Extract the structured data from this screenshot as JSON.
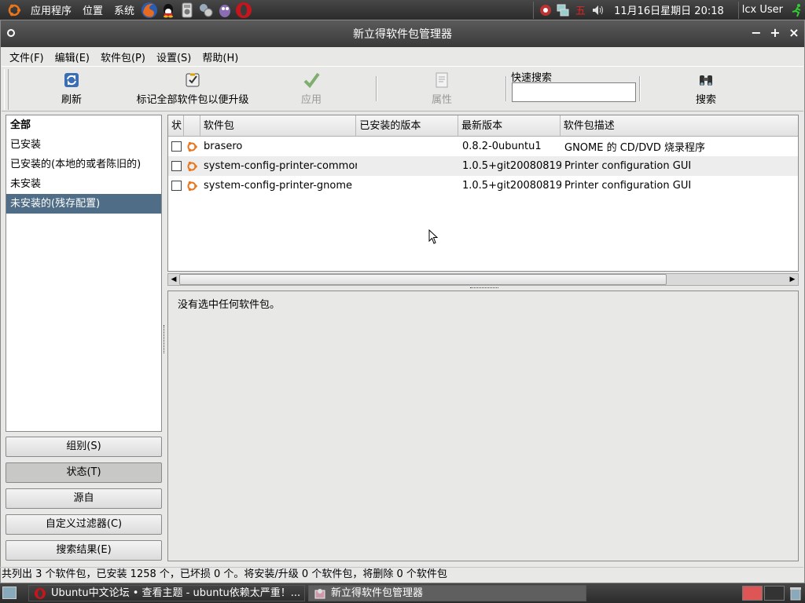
{
  "top_panel": {
    "menus": [
      "应用程序",
      "位置",
      "系统"
    ],
    "launchers": [
      "firefox-icon",
      "qq-icon",
      "media-player-icon",
      "network-tool-icon",
      "pidgin-icon",
      "opera-icon"
    ],
    "tray": [
      "update-icon",
      "network-icon",
      "input-method-icon",
      "volume-icon"
    ],
    "clock": "11月16日星期日 20:18",
    "user": "lcx User"
  },
  "window": {
    "title": "新立得软件包管理器",
    "controls": [
      "−",
      "+",
      "×"
    ]
  },
  "menubar": [
    "文件(F)",
    "编辑(E)",
    "软件包(P)",
    "设置(S)",
    "帮助(H)"
  ],
  "toolbar": {
    "refresh": "刷新",
    "mark_all": "标记全部软件包以便升级",
    "apply": "应用",
    "properties": "属性",
    "quick_search_label": "快速搜索",
    "quick_search_value": "",
    "search": "搜索"
  },
  "filters": {
    "items": [
      "全部",
      "已安装",
      "已安装的(本地的或者陈旧的)",
      "未安装",
      "未安装的(残存配置)"
    ],
    "selected_index": 4
  },
  "filter_buttons": [
    "组别(S)",
    "状态(T)",
    "源自",
    "自定义过滤器(C)",
    "搜索结果(E)"
  ],
  "package_table": {
    "columns": [
      "状",
      "",
      "软件包",
      "已安装的版本",
      "最新版本",
      "软件包描述"
    ],
    "rows": [
      {
        "name": "brasero",
        "installed": "",
        "latest": "0.8.2-0ubuntu1",
        "description": "GNOME 的 CD/DVD 烧录程序"
      },
      {
        "name": "system-config-printer-commor",
        "installed": "",
        "latest": "1.0.5+git20080819·",
        "description": "Printer configuration GUI"
      },
      {
        "name": "system-config-printer-gnome",
        "installed": "",
        "latest": "1.0.5+git20080819·",
        "description": "Printer configuration GUI"
      }
    ]
  },
  "detail": {
    "message": "没有选中任何软件包。"
  },
  "status_bar": "共列出 3 个软件包，已安装 1258 个，已坏损 0 个。将安装/升级 0 个软件包，将删除 0 个软件包",
  "taskbar": {
    "tasks": [
      "Ubuntu中文论坛 • 查看主题 - ubuntu依赖太严重！...",
      "新立得软件包管理器"
    ]
  },
  "colors": {
    "selection": "#4f6d86",
    "panel": "#3a3a3a",
    "window_bg": "#e8e8e7"
  }
}
